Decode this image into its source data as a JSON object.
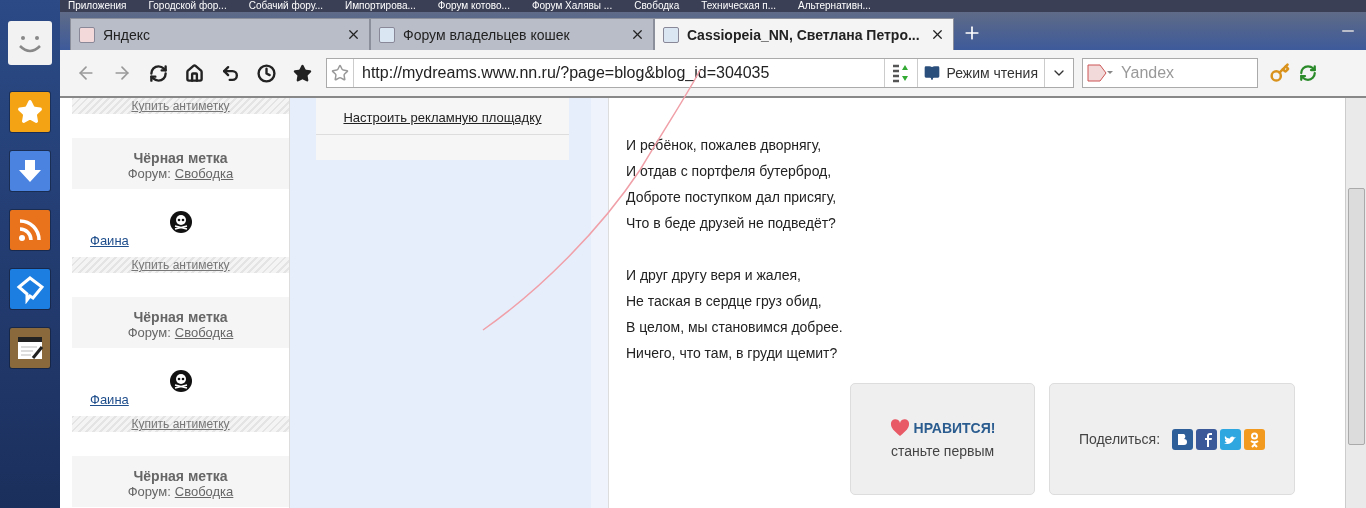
{
  "bookmarks": [
    "Приложения",
    "Городской фор...",
    "Собачий фору...",
    "Импортирова...",
    "Форум котово...",
    "Форум Халявы ...",
    "Свободка",
    "Техническая п...",
    "Альтернативн..."
  ],
  "tabs": [
    {
      "title": "Яндекс",
      "selected": false,
      "kind": "yandex"
    },
    {
      "title": "Форум владельцев кошек",
      "selected": false,
      "kind": "page"
    },
    {
      "title": "Cassiopeia_NN, Светлана Петро...",
      "selected": true,
      "kind": "page"
    }
  ],
  "toolbar": {
    "url": "http://mydreams.www.nn.ru/?page=blog&blog_id=304035",
    "reading_mode": "Режим чтения",
    "search_placeholder": "Yandex"
  },
  "left_column": {
    "top_buy": "Купить антиметку",
    "cards": [
      {
        "title": "Чёрная метка",
        "forum_label": "Форум:",
        "forum_link": "Свободка",
        "user": "Фаина",
        "buy": "Купить антиметку"
      },
      {
        "title": "Чёрная метка",
        "forum_label": "Форум:",
        "forum_link": "Свободка",
        "user": "Фаина",
        "buy": "Купить антиметку"
      },
      {
        "title": "Чёрная метка",
        "forum_label": "Форум:",
        "forum_link": "Свободка"
      }
    ]
  },
  "ad_panel": {
    "link": "Настроить рекламную площадку"
  },
  "poem": {
    "stanzas": [
      [
        "И ребёнок, пожалев дворнягу,",
        "И отдав с портфеля бутерброд,",
        "Доброте поступком дал присягу,",
        "Что в беде друзей не подведёт?"
      ],
      [
        "И друг другу веря и жалея,",
        "Не таская в сердце груз обид,",
        "В целом, мы становимся добрее.",
        "Ничего, что там, в груди щемит?"
      ]
    ]
  },
  "like": {
    "label": "НРАВИТСЯ!",
    "subtitle": "станьте первым"
  },
  "share": {
    "label": "Поделиться:",
    "networks": [
      {
        "kind": "vk",
        "color": "#2f5f99"
      },
      {
        "kind": "facebook",
        "color": "#3b5998"
      },
      {
        "kind": "twitter",
        "color": "#2ea7e0"
      },
      {
        "kind": "odnoklassniki",
        "color": "#f29a1f"
      }
    ]
  }
}
